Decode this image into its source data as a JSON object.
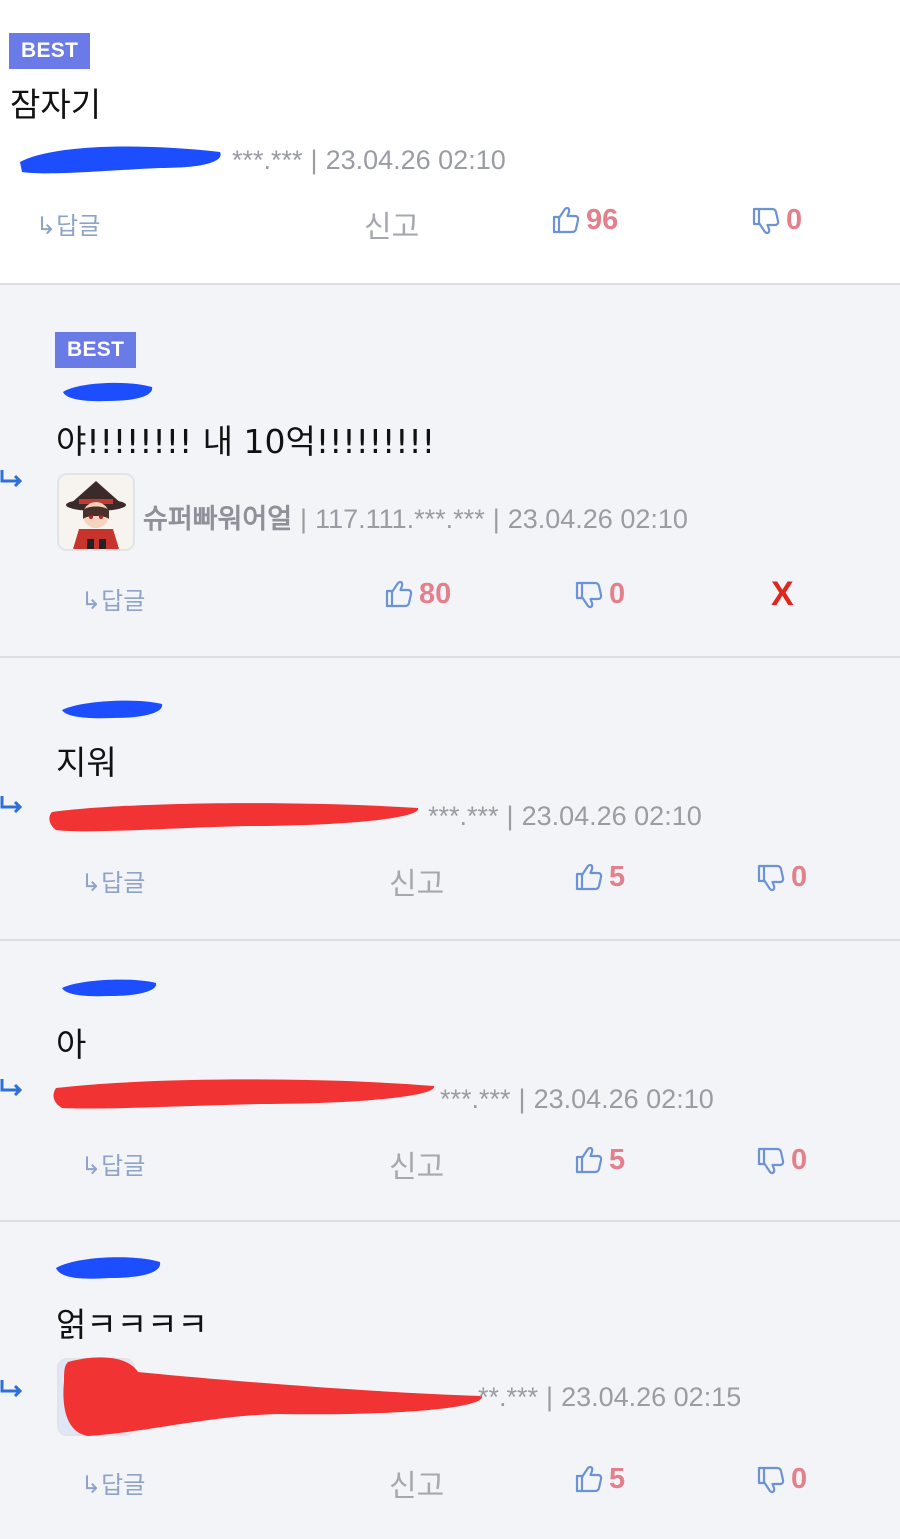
{
  "comments": [
    {
      "best_label": "BEST",
      "text": "잠자기",
      "meta_tail": "***.***",
      "datetime": "23.04.26 02:10",
      "reply_label": "↳답글",
      "report_label": "신고",
      "up_count": "96",
      "down_count": "0"
    },
    {
      "best_label": "BEST",
      "text": "야!!!!!!!! 내 10억!!!!!!!!!",
      "nickname": "슈퍼빠워어얼",
      "ip": "117.111.***.***",
      "datetime": "23.04.26 02:10",
      "reply_label": "↳답글",
      "up_count": "80",
      "down_count": "0",
      "delete_label": "X"
    },
    {
      "text": "지워",
      "meta_tail": "***.***",
      "datetime": "23.04.26 02:10",
      "reply_label": "↳답글",
      "report_label": "신고",
      "up_count": "5",
      "down_count": "0"
    },
    {
      "text": "아",
      "meta_tail": "***.***",
      "datetime": "23.04.26 02:10",
      "reply_label": "↳답글",
      "report_label": "신고",
      "up_count": "5",
      "down_count": "0"
    },
    {
      "text": "얽ㅋㅋㅋㅋ",
      "meta_tail": "**.***",
      "datetime": "23.04.26 02:15",
      "reply_label": "↳답글",
      "report_label": "신고",
      "up_count": "5",
      "down_count": "0"
    }
  ],
  "colors": {
    "best_badge": "#6a7ae6",
    "vote_count": "#e4808c",
    "thumb_icon": "#6b93d6",
    "delete": "#e0261e",
    "redact_blue": "#1c4dff",
    "redact_red": "#f23333",
    "arrow": "#2e6fd8"
  }
}
